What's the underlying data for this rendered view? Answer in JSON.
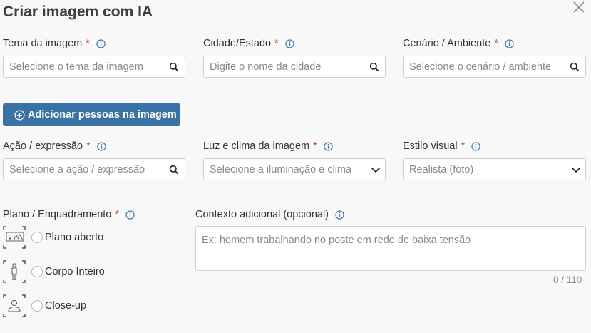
{
  "dialog": {
    "title": "Criar imagem com IA"
  },
  "fields": {
    "tema": {
      "label": "Tema da imagem",
      "required_mark": "*",
      "placeholder": "Selecione o tema da imagem"
    },
    "cidade": {
      "label": "Cidade/Estado",
      "required_mark": "*",
      "placeholder": "Digite o nome da cidade"
    },
    "cenario": {
      "label": "Cenário / Ambiente",
      "required_mark": "*",
      "placeholder": "Selecione o cenário / ambiente"
    },
    "acao": {
      "label": "Ação / expressão",
      "required_mark": "*",
      "placeholder": "Selecione a ação / expressão"
    },
    "luz": {
      "label": "Luz e clima da imagem",
      "required_mark": "*",
      "placeholder": "Selecione a iluminação e clima"
    },
    "estilo": {
      "label": "Estilo visual",
      "required_mark": "*",
      "value": "Realista (foto)"
    }
  },
  "add_people_button": {
    "label": "Adicionar pessoas na imagem"
  },
  "plano": {
    "label": "Plano / Enquadramento",
    "required_mark": "*",
    "options": [
      {
        "label": "Plano aberto",
        "icon": "wide-shot-icon"
      },
      {
        "label": "Corpo Inteiro",
        "icon": "full-body-icon"
      },
      {
        "label": "Close-up",
        "icon": "close-up-icon"
      }
    ]
  },
  "contexto": {
    "label": "Contexto adicional (opcional)",
    "placeholder": "Ex: homem trabalhando no poste em rede de baixa tensão",
    "counter": "0 / 110"
  },
  "colors": {
    "accent": "#3a72a6",
    "required": "#d12d2d",
    "info": "#3a72a6"
  }
}
